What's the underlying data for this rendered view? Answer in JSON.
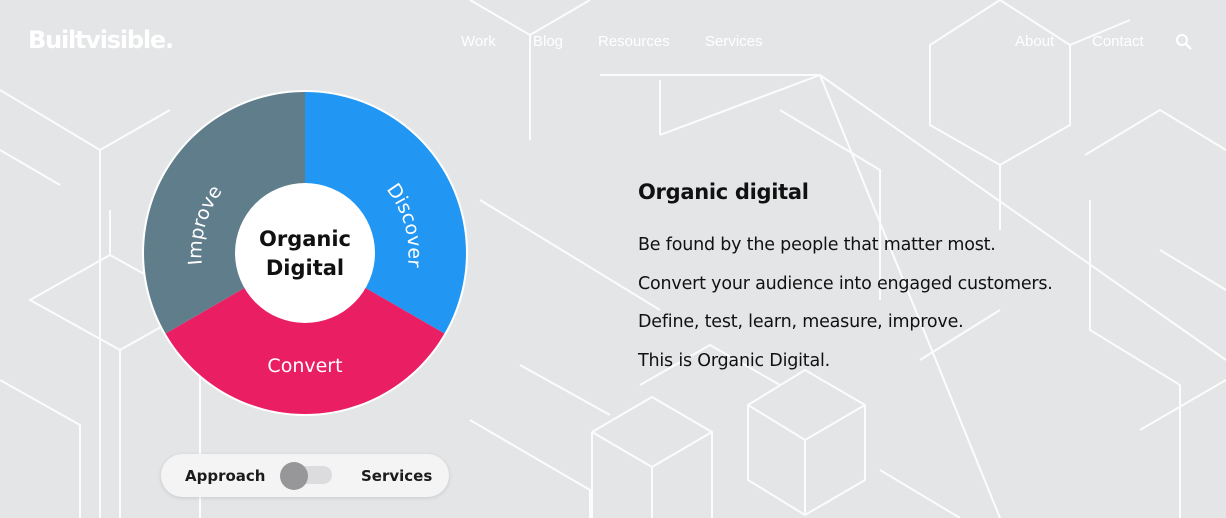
{
  "brand": {
    "logo_text": "Builtvisible."
  },
  "nav": {
    "primary": [
      "Work",
      "Blog",
      "Resources",
      "Services"
    ],
    "secondary": [
      "About",
      "Contact"
    ],
    "search_icon": "search-icon"
  },
  "wheel": {
    "center": {
      "line1": "Organic",
      "line2": "Digital"
    },
    "segments": [
      {
        "label": "Discover",
        "color": "#2196f3"
      },
      {
        "label": "Convert",
        "color": "#e91e63"
      },
      {
        "label": "Improve",
        "color": "#607d8b"
      }
    ]
  },
  "content": {
    "title": "Organic digital",
    "lines": [
      "Be found by the people that matter most.",
      "Convert your audience into engaged customers.",
      "Define, test, learn, measure, improve.",
      "This is Organic Digital."
    ]
  },
  "toggle": {
    "left_label": "Approach",
    "right_label": "Services",
    "selected": "Approach"
  },
  "colors": {
    "background": "#e3e5e7",
    "text": "#111111",
    "line_art": "#ffffff"
  }
}
